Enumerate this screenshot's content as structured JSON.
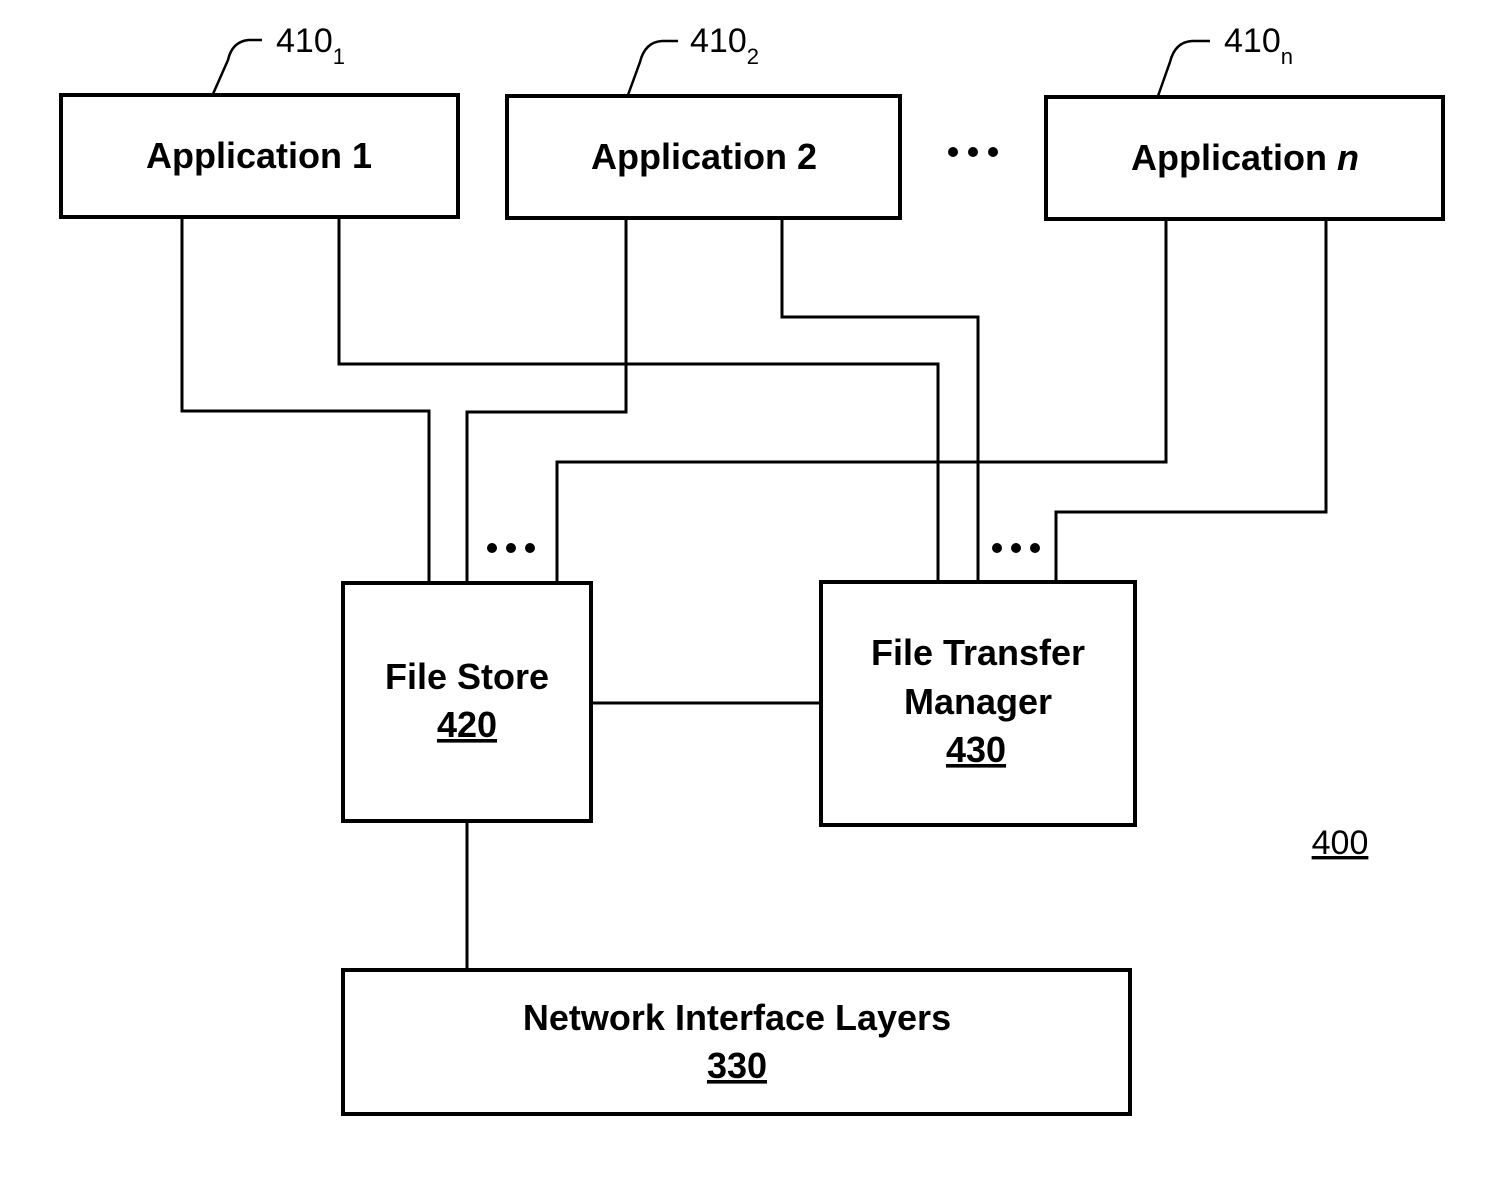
{
  "figure": {
    "figure_ref": "400",
    "applications": [
      {
        "label": "Application 1",
        "label_base": "Application ",
        "label_var": "1",
        "ref_base": "410",
        "ref_sub": "1"
      },
      {
        "label": "Application 2",
        "label_base": "Application ",
        "label_var": "2",
        "ref_base": "410",
        "ref_sub": "2"
      },
      {
        "label": "Application n",
        "label_base": "Application ",
        "label_var": "n",
        "ref_base": "410",
        "ref_sub": "n"
      }
    ],
    "ellipsis": "•••",
    "file_store": {
      "label": "File Store",
      "ref": "420"
    },
    "file_transfer_manager": {
      "label_line1": "File Transfer",
      "label_line2": "Manager",
      "ref": "430"
    },
    "network_interface": {
      "label": "Network Interface Layers",
      "ref": "330"
    },
    "connections": [
      {
        "from": "Application 1",
        "to": "File Store"
      },
      {
        "from": "Application 1",
        "to": "File Transfer Manager"
      },
      {
        "from": "Application 2",
        "to": "File Store"
      },
      {
        "from": "Application 2",
        "to": "File Transfer Manager"
      },
      {
        "from": "Application n",
        "to": "File Store"
      },
      {
        "from": "Application n",
        "to": "File Transfer Manager"
      },
      {
        "from": "File Store",
        "to": "File Transfer Manager"
      },
      {
        "from": "File Store",
        "to": "Network Interface Layers"
      }
    ]
  }
}
